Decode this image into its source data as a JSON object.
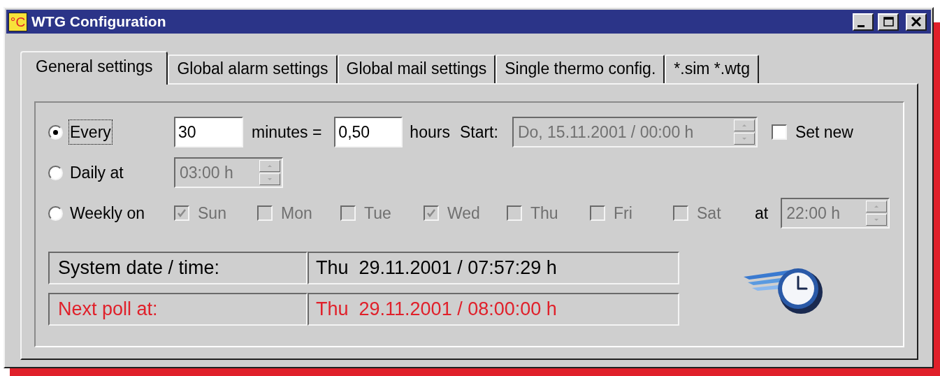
{
  "window": {
    "title": "WTG Configuration",
    "app_icon": "°C"
  },
  "tabs": [
    {
      "label": "General settings",
      "selected": true
    },
    {
      "label": "Global alarm settings",
      "selected": false
    },
    {
      "label": "Global mail settings",
      "selected": false
    },
    {
      "label": "Single thermo config.",
      "selected": false
    },
    {
      "label": "*.sim *.wtg",
      "selected": false
    }
  ],
  "schedule": [
    {
      "kind": "every",
      "label": "Every",
      "selected": true,
      "focused": true,
      "minutes": "30",
      "minutes_label": "minutes =",
      "hours": "0,50",
      "hours_label": "hours",
      "start_label": "Start:",
      "start": {
        "value": "Do, 15.11.2001 / 00:00 h",
        "disabled": true
      },
      "set_new": {
        "label": "Set new",
        "checked": false,
        "disabled": false
      }
    },
    {
      "kind": "daily",
      "label": "Daily at",
      "selected": false,
      "focused": false,
      "time": {
        "value": "03:00 h",
        "disabled": true
      }
    },
    {
      "kind": "weekly",
      "label": "Weekly on",
      "selected": false,
      "focused": false,
      "days": [
        {
          "label": "Sun",
          "checked": true,
          "disabled": true
        },
        {
          "label": "Mon",
          "checked": false,
          "disabled": true
        },
        {
          "label": "Tue",
          "checked": false,
          "disabled": true
        },
        {
          "label": "Wed",
          "checked": true,
          "disabled": true
        },
        {
          "label": "Thu",
          "checked": false,
          "disabled": true
        },
        {
          "label": "Fri",
          "checked": false,
          "disabled": true
        },
        {
          "label": "Sat",
          "checked": false,
          "disabled": true
        }
      ],
      "at_label": "at",
      "time": {
        "value": "22:00 h",
        "disabled": true
      }
    }
  ],
  "info": [
    {
      "label": "System date / time:",
      "value": "Thu  29.11.2001 / 07:57:29 h",
      "color": "#000000"
    },
    {
      "label": "Next poll at:",
      "value": "Thu  29.11.2001 / 08:00:00 h",
      "color": "#e0202a"
    }
  ]
}
